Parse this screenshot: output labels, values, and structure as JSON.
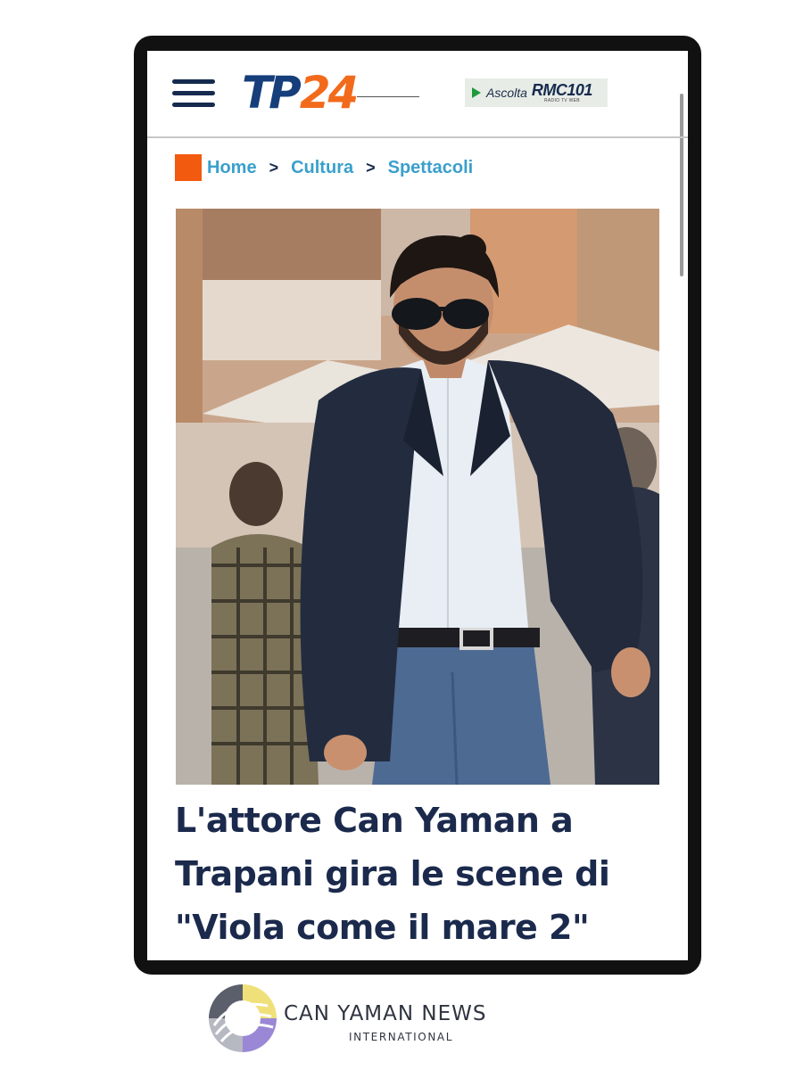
{
  "header": {
    "menu_icon": "hamburger-menu-icon",
    "logo_text_main": "TP",
    "logo_text_num": "24",
    "radio": {
      "play_icon": "play-icon",
      "label": "Ascolta",
      "brand": "RMC101",
      "brand_sub": "RADIO TV WEB"
    }
  },
  "breadcrumb": {
    "items": [
      "Home",
      "Cultura",
      "Spettacoli"
    ],
    "separator": ">"
  },
  "article": {
    "image_alt": "Man with sunglasses in a dark blazer, white shirt and jeans walking on a street",
    "headline_lines": [
      "L'attore Can Yaman a",
      "Trapani gira le scene di",
      "\"Viola come il mare 2\""
    ]
  },
  "brand": {
    "name": "CAN YAMAN NEWS",
    "sub": "INTERNATIONAL"
  },
  "colors": {
    "accent_orange": "#f25a0f",
    "link_blue": "#3aa0cb",
    "navy": "#152a4e",
    "headline": "#1b2a4c"
  }
}
